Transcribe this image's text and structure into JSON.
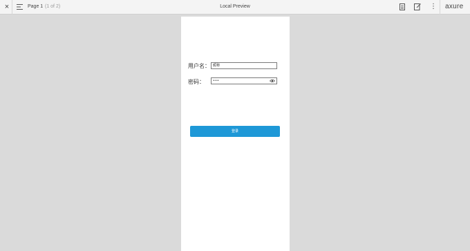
{
  "toolbar": {
    "close_symbol": "×",
    "page_label": "Page 1",
    "page_count": "(1 of 2)",
    "title": "Local Preview",
    "more_symbol": "⋮",
    "logo": "axure"
  },
  "form": {
    "username_label": "用户名：",
    "username_value": "昵称",
    "password_label": "密码：",
    "password_value": "•••",
    "login_label": "登录"
  },
  "icons": {
    "close": "close-icon",
    "menu": "menu-icon",
    "notes": "notes-icon",
    "inspect": "inspect-icon",
    "more": "more-icon",
    "eye": "eye-icon"
  },
  "colors": {
    "background": "#dadada",
    "toolbar": "#f4f4f4",
    "canvas": "#ffffff",
    "button": "#1e98d7"
  }
}
